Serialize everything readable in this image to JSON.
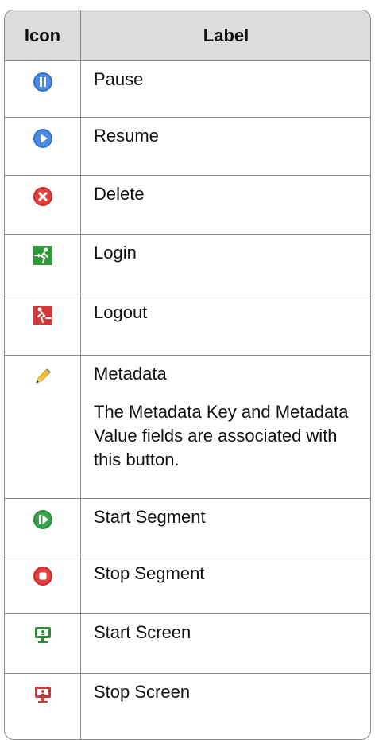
{
  "table": {
    "headers": {
      "icon": "Icon",
      "label": "Label"
    },
    "rows": [
      {
        "icon": "pause-icon",
        "label": "Pause",
        "description": ""
      },
      {
        "icon": "resume-icon",
        "label": "Resume",
        "description": ""
      },
      {
        "icon": "delete-icon",
        "label": "Delete",
        "description": ""
      },
      {
        "icon": "login-icon",
        "label": "Login",
        "description": ""
      },
      {
        "icon": "logout-icon",
        "label": "Logout",
        "description": ""
      },
      {
        "icon": "pencil-icon",
        "label": "Metadata",
        "description": "The Metadata Key and Metadata Value fields are associated with this button."
      },
      {
        "icon": "start-segment-icon",
        "label": "Start Segment",
        "description": ""
      },
      {
        "icon": "stop-segment-icon",
        "label": "Stop Segment",
        "description": ""
      },
      {
        "icon": "start-screen-icon",
        "label": "Start Screen",
        "description": ""
      },
      {
        "icon": "stop-screen-icon",
        "label": "Stop Screen",
        "description": ""
      }
    ]
  }
}
